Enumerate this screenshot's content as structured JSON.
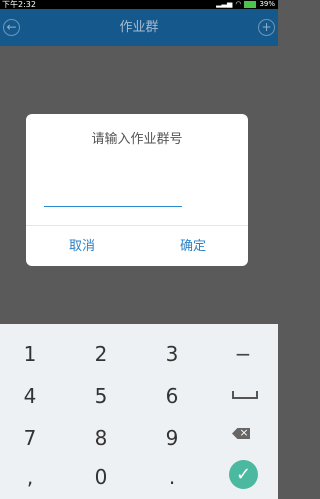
{
  "status_bar": {
    "time": "下午2:32",
    "battery": "39%",
    "icons": [
      "signal-icon",
      "wifi-icon",
      "battery-icon"
    ]
  },
  "app_bar": {
    "title": "作业群",
    "back_icon": "back-circle-icon",
    "add_icon": "add-circle-icon"
  },
  "dialog": {
    "title": "请输入作业群号",
    "input_value": "",
    "cancel": "取消",
    "confirm": "确定"
  },
  "keyboard": {
    "rows": [
      [
        "1",
        "2",
        "3",
        "−"
      ],
      [
        "4",
        "5",
        "6",
        "␣"
      ],
      [
        "7",
        "8",
        "9",
        "⌫"
      ],
      [
        ",",
        "0",
        ".",
        "✓"
      ]
    ]
  },
  "colors": {
    "app_bar": "#15598c",
    "accent": "#2b82c6",
    "done": "#4bb8a0"
  }
}
